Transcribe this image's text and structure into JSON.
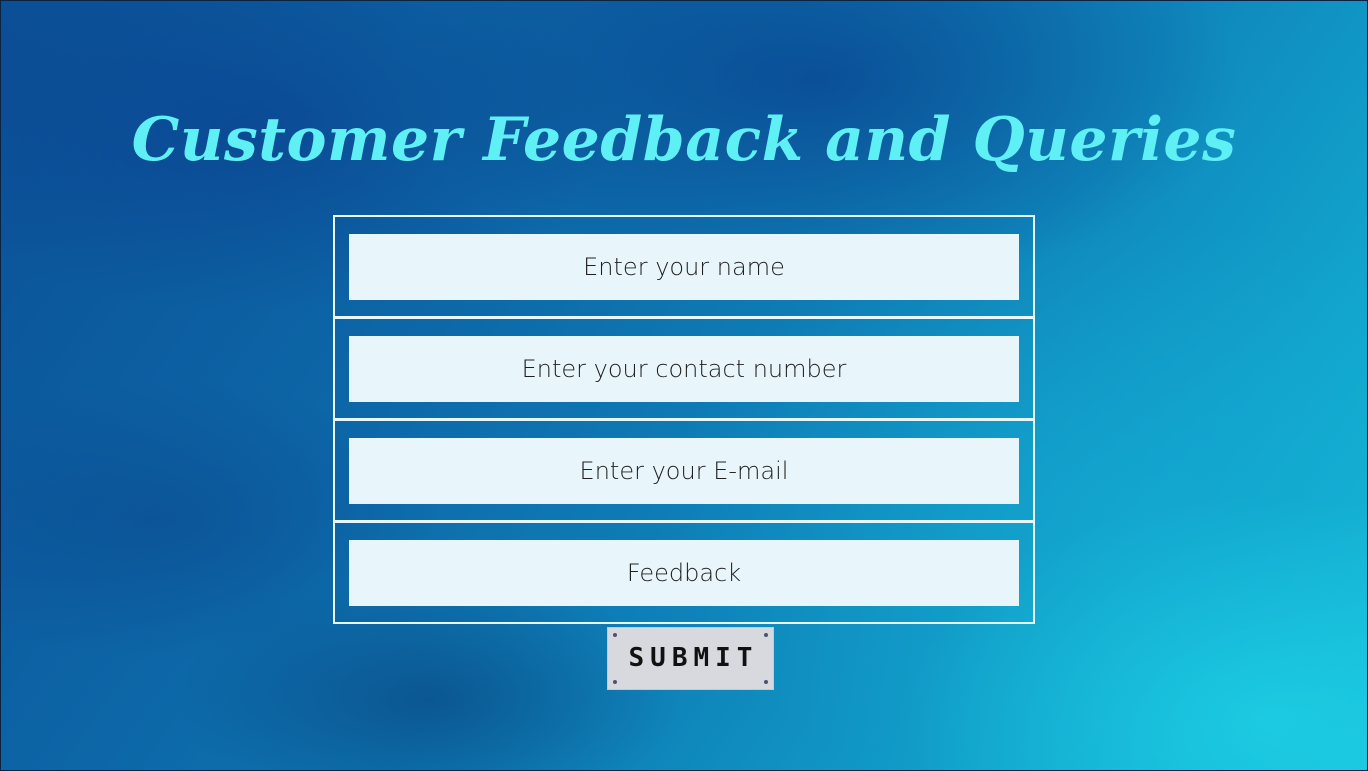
{
  "page": {
    "title": "Customer Feedback and Queries"
  },
  "form": {
    "fields": [
      {
        "placeholder": "Enter your name",
        "value": ""
      },
      {
        "placeholder": "Enter your contact number",
        "value": ""
      },
      {
        "placeholder": "Enter your E-mail",
        "value": ""
      },
      {
        "placeholder": "Feedback",
        "value": ""
      }
    ],
    "submit_label": "SUBMIT"
  },
  "colors": {
    "title": "#5ff0f5",
    "field_background": "#e8f6fc",
    "field_border": "#e6f6fb",
    "button_background": "#d8d9de",
    "ocean_dark": "#0b4f96",
    "ocean_light": "#18c2db"
  }
}
